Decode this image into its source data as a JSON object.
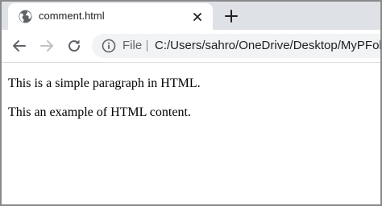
{
  "tab": {
    "title": "comment.html",
    "favicon": "globe-icon",
    "close_icon": "close-icon"
  },
  "new_tab_icon": "plus-icon",
  "toolbar": {
    "back_icon": "back-arrow-icon",
    "forward_icon": "forward-arrow-icon",
    "reload_icon": "reload-icon"
  },
  "omnibox": {
    "info_icon": "info-icon",
    "scheme": "File",
    "url": "C:/Users/sahro/OneDrive/Desktop/MyPFolder"
  },
  "page": {
    "paragraphs": [
      "This is a simple paragraph in HTML.",
      "This an example of HTML content."
    ]
  },
  "colors": {
    "tabstrip": "#dee1e6",
    "omnibox": "#f1f3f4",
    "window_border": "#8a8a8a",
    "icon_gray": "#5f6368",
    "disabled_icon": "#bdc1c6"
  }
}
